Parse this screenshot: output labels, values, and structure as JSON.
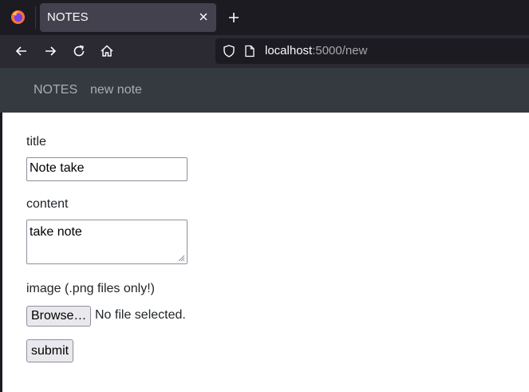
{
  "browser": {
    "tab_title": "NOTES",
    "url_host": "localhost",
    "url_rest": ":5000/new"
  },
  "site": {
    "brand": "NOTES",
    "nav_link": "new note"
  },
  "form": {
    "title_label": "title",
    "title_value": "Note take",
    "content_label": "content",
    "content_value": "take note",
    "image_label": "image (.png files only!)",
    "browse_label": "Browse…",
    "file_status": "No file selected.",
    "submit_label": "submit"
  },
  "colors": {
    "chrome_dark": "#1c1b22",
    "toolbar": "#2b2a33",
    "site_nav": "#343a40"
  }
}
